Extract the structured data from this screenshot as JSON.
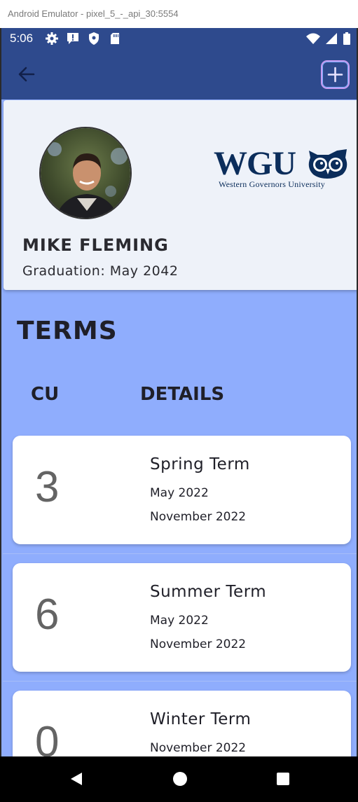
{
  "emulator": {
    "title": "Android Emulator - pixel_5_-_api_30:5554"
  },
  "status_bar": {
    "time": "5:06",
    "left_icons": [
      "gear-icon",
      "alert-icon",
      "shield-icon",
      "sd-card-icon"
    ],
    "right_icons": [
      "wifi-icon",
      "signal-icon",
      "battery-icon"
    ]
  },
  "app_bar": {
    "back_icon": "arrow-left-icon",
    "add_icon": "plus-icon",
    "color": "#2e4a8d",
    "add_border_color": "#c89cf2"
  },
  "profile": {
    "name": "MIKE FLEMING",
    "graduation": "Graduation: May 2042",
    "logo_text": "WGU",
    "logo_subtitle": "Western Governors University"
  },
  "terms_section": {
    "title": "TERMS",
    "col_cu": "CU",
    "col_details": "DETAILS",
    "background": "#8fadfd"
  },
  "terms": [
    {
      "cu": "3",
      "name": "Spring Term",
      "start": "May 2022",
      "end": "November 2022"
    },
    {
      "cu": "6",
      "name": "Summer Term",
      "start": "May 2022",
      "end": "November 2022"
    },
    {
      "cu": "0",
      "name": "Winter Term",
      "start": "November 2022",
      "end": ""
    }
  ],
  "nav_bar": {
    "icons": [
      "back-triangle-icon",
      "home-circle-icon",
      "recents-square-icon"
    ]
  }
}
